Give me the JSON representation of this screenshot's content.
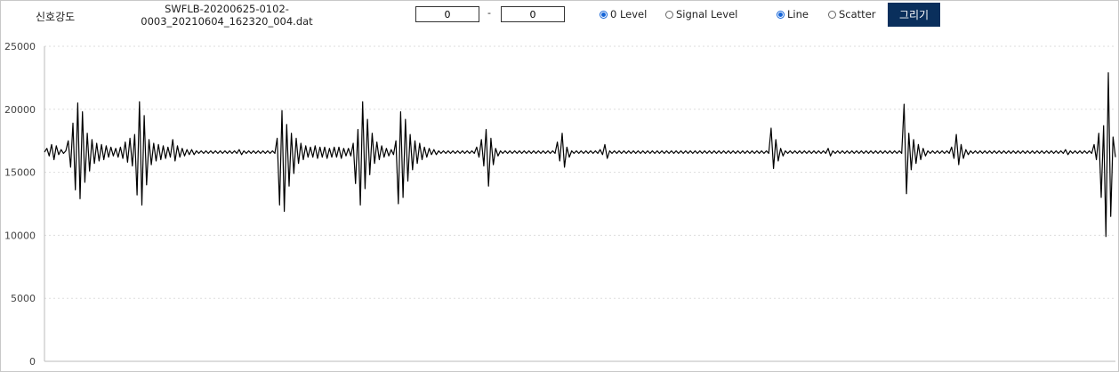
{
  "header": {
    "title": "신호강도",
    "filename_line1": "SWFLB-20200625-0102-",
    "filename_line2": "0003_20210604_162320_004.dat",
    "range_start": "0",
    "range_separator": "-",
    "range_end": "0",
    "draw_button_label": "그리기"
  },
  "options": {
    "level_mode": [
      {
        "label": "0 Level",
        "selected": true
      },
      {
        "label": "Signal Level",
        "selected": false
      }
    ],
    "plot_mode": [
      {
        "label": "Line",
        "selected": true
      },
      {
        "label": "Scatter",
        "selected": false
      }
    ]
  },
  "colors": {
    "accent": "#1565d8",
    "button_bg": "#0a2f5c",
    "series": "#000000",
    "grid": "#dddddd"
  },
  "chart_data": {
    "type": "line",
    "title": "",
    "xlabel": "",
    "ylabel": "",
    "ylim": [
      0,
      25000
    ],
    "yticks": [
      0,
      5000,
      10000,
      15000,
      20000,
      25000
    ],
    "ytick_labels": [
      "0",
      "5000",
      "10000",
      "15000",
      "20000",
      "25000"
    ],
    "grid": "horizontal dotted",
    "baseline": 16600,
    "series": [
      {
        "values": [
          16600,
          16900,
          16300,
          17200,
          16000,
          17100,
          16400,
          16800,
          16500,
          16700,
          17500,
          15400,
          18900,
          13600,
          20500,
          12900,
          19800,
          14200,
          18100,
          15100,
          17600,
          15700,
          17300,
          15900,
          17200,
          16000,
          17100,
          16200,
          17000,
          16300,
          16900,
          16200,
          17000,
          16100,
          17400,
          15800,
          17700,
          15500,
          18000,
          13200,
          20600,
          12400,
          19500,
          14000,
          17600,
          15600,
          17300,
          15900,
          17200,
          16000,
          17100,
          16100,
          17000,
          16200,
          17600,
          15900,
          17100,
          16200,
          16900,
          16300,
          16800,
          16400,
          16800,
          16400,
          16700,
          16500,
          16700,
          16500,
          16700,
          16500,
          16700,
          16500,
          16700,
          16500,
          16700,
          16500,
          16700,
          16500,
          16700,
          16500,
          16700,
          16500,
          16800,
          16400,
          16700,
          16500,
          16700,
          16500,
          16700,
          16500,
          16700,
          16500,
          16700,
          16500,
          16700,
          16500,
          16700,
          16500,
          17700,
          12400,
          19900,
          11900,
          18800,
          13900,
          18100,
          14900,
          17700,
          15700,
          17300,
          16000,
          17100,
          16200,
          17000,
          16200,
          17100,
          16100,
          17000,
          16200,
          17000,
          16100,
          16900,
          16200,
          17000,
          16200,
          17000,
          16100,
          16900,
          16300,
          16900,
          16300,
          17300,
          14100,
          18400,
          12400,
          20600,
          13700,
          19200,
          14800,
          18100,
          15700,
          17400,
          16000,
          17100,
          16200,
          16900,
          16300,
          16800,
          16400,
          17500,
          12500,
          19800,
          13000,
          19200,
          14300,
          18000,
          15200,
          17500,
          15700,
          17300,
          16000,
          17000,
          16200,
          16900,
          16400,
          16800,
          16400,
          16700,
          16500,
          16700,
          16500,
          16700,
          16500,
          16700,
          16500,
          16700,
          16500,
          16700,
          16500,
          16700,
          16500,
          16700,
          16500,
          17000,
          16200,
          17600,
          15500,
          18400,
          13900,
          17700,
          15600,
          16900,
          16300,
          16700,
          16500,
          16700,
          16500,
          16700,
          16500,
          16700,
          16500,
          16700,
          16500,
          16700,
          16500,
          16700,
          16500,
          16700,
          16500,
          16700,
          16500,
          16700,
          16500,
          16700,
          16500,
          16700,
          16500,
          17400,
          15900,
          18100,
          15400,
          17000,
          16200,
          16700,
          16500,
          16700,
          16500,
          16700,
          16500,
          16700,
          16500,
          16700,
          16500,
          16700,
          16500,
          16800,
          16400,
          17200,
          16100,
          16700,
          16500,
          16700,
          16500,
          16700,
          16500,
          16700,
          16500,
          16700,
          16500,
          16700,
          16500,
          16700,
          16500,
          16700,
          16500,
          16700,
          16500,
          16700,
          16500,
          16700,
          16500,
          16700,
          16500,
          16700,
          16500,
          16700,
          16500,
          16700,
          16500,
          16700,
          16500,
          16700,
          16500,
          16700,
          16500,
          16700,
          16500,
          16700,
          16500,
          16700,
          16500,
          16700,
          16500,
          16700,
          16500,
          16700,
          16500,
          16700,
          16500,
          16700,
          16500,
          16700,
          16500,
          16700,
          16500,
          16700,
          16500,
          16700,
          16500,
          16700,
          16500,
          16700,
          16500,
          16700,
          16500,
          16700,
          16500,
          18500,
          15300,
          17600,
          15900,
          16900,
          16300,
          16700,
          16500,
          16700,
          16500,
          16700,
          16500,
          16700,
          16500,
          16700,
          16500,
          16700,
          16500,
          16700,
          16500,
          16700,
          16500,
          16700,
          16500,
          16900,
          16300,
          16700,
          16500,
          16700,
          16500,
          16700,
          16500,
          16700,
          16500,
          16700,
          16500,
          16700,
          16500,
          16700,
          16500,
          16700,
          16500,
          16700,
          16500,
          16700,
          16500,
          16700,
          16500,
          16700,
          16500,
          16700,
          16500,
          16700,
          16500,
          16700,
          16500,
          20400,
          13300,
          18100,
          15200,
          17600,
          15700,
          17200,
          16000,
          16900,
          16300,
          16700,
          16500,
          16700,
          16500,
          16700,
          16500,
          16700,
          16500,
          16700,
          16500,
          17000,
          16100,
          18000,
          15600,
          17200,
          16100,
          16800,
          16400,
          16700,
          16500,
          16700,
          16500,
          16700,
          16500,
          16700,
          16500,
          16700,
          16500,
          16700,
          16500,
          16700,
          16500,
          16700,
          16500,
          16700,
          16500,
          16700,
          16500,
          16700,
          16500,
          16700,
          16500,
          16700,
          16500,
          16700,
          16500,
          16700,
          16500,
          16700,
          16500,
          16700,
          16500,
          16700,
          16500,
          16700,
          16500,
          16700,
          16500,
          16800,
          16400,
          16700,
          16500,
          16700,
          16500,
          16700,
          16500,
          16700,
          16500,
          16700,
          16500,
          17200,
          16000,
          18100,
          13000,
          18700,
          9900,
          22900,
          11500,
          17800,
          16200
        ]
      }
    ]
  }
}
